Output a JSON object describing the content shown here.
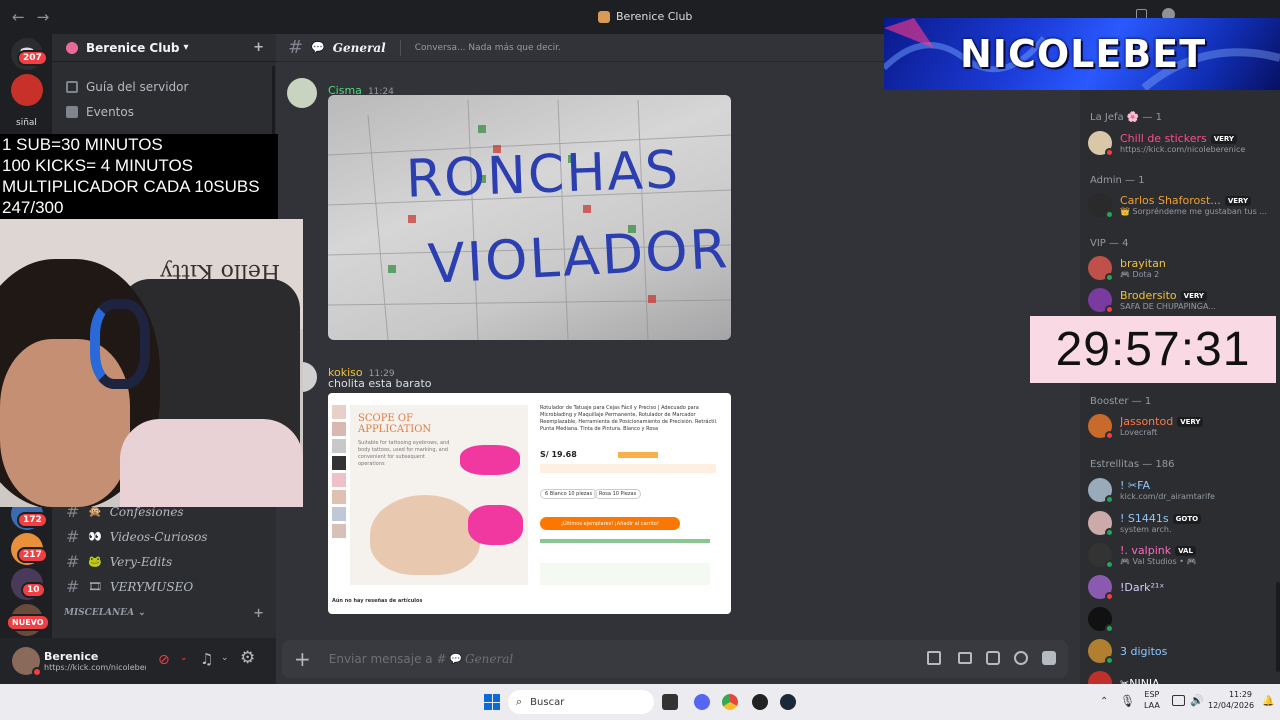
{
  "window": {
    "title": "Berenice Club",
    "back": "←",
    "forward": "→"
  },
  "server": {
    "name": "Berenice Club",
    "chevron": "▾"
  },
  "rail": {
    "dm_badge": "207",
    "server_label": "siñal",
    "badges": [
      "172",
      "217",
      "10"
    ],
    "nuevo": "NUEVO"
  },
  "sidebar": {
    "items": [
      {
        "label": "Guía del servidor",
        "icon": "signpost-icon"
      },
      {
        "label": "Eventos",
        "icon": "calendar-icon"
      }
    ],
    "channels": [
      {
        "emoji": "🙊",
        "label": "Confesiones"
      },
      {
        "emoji": "👀",
        "label": "Videos-Curiosos"
      },
      {
        "emoji": "🐸",
        "label": "Very-Edits"
      },
      {
        "emoji": "🎞",
        "label": "VERYMUSEO"
      }
    ],
    "category": "MISCELANEA"
  },
  "user": {
    "name": "Berenice",
    "status": "https://kick.com/nicoleber"
  },
  "channel": {
    "emoji": "💬",
    "name": "General",
    "topic": "Conversa... Nada más que decir."
  },
  "messages": [
    {
      "author": "Cisma",
      "time": "11:24",
      "color": "#4fdc7c",
      "image_text_1": "RONCHAS",
      "image_text_2": "VIOLADOR"
    },
    {
      "author": "kokiso",
      "time": "11:29",
      "color": "#f0c23b",
      "text": "cholita esta barato",
      "product": {
        "scope_title": "SCOPE OF APPLICATION",
        "scope_desc": "Suitable for tattooing eyebrows, and body tattoos, used for marking, and convenient for subsequent operations",
        "name": "Rotulador de Tatuaje para Cejas Fácil y Preciso | Adecuado para Microblading y Maquillaje Permanente, Rotulador de Marcador Reemplazable, Herramienta de Posicionamiento de Precisión. Retráctil. Punta Mediana. Tinta de Pintura. Blanco y Rosa",
        "price": "S/ 19.68",
        "button": "¡Últimos ejemplares! ¡Añadir al carrito!",
        "opt1": "6 Blanco 10 piezas",
        "opt2": "Rosa 10 Piezas",
        "reviews": "Aún no hay reseñas de artículos"
      }
    }
  ],
  "composer": {
    "placeholder": "Enviar mensaje a #",
    "channel": "General"
  },
  "members": {
    "groups": [
      {
        "label": "La Jefa 🌸 — 1"
      },
      {
        "label": "Admin — 1"
      },
      {
        "label": "VIP — 4"
      },
      {
        "label": "Booster — 1"
      },
      {
        "label": "Estrellitas — 186"
      }
    ],
    "list": [
      {
        "name": "Chill de stickers",
        "tag": "VERY",
        "sub": "https://kick.com/nicoleberenice",
        "color": "#ff4d8d",
        "av": "#d8c8a8",
        "st": "#f23f43"
      },
      {
        "name": "Carlos Shaforost...",
        "tag": "VERY",
        "sub": "👑 Sorpréndeme me gustaban tus ...",
        "color": "#f0a030",
        "av": "#2a2a2a",
        "st": "#23a55a"
      },
      {
        "name": "brayitan",
        "tag": "",
        "sub": "🎮 Dota 2",
        "color": "#f0c23b",
        "av": "#c0504a",
        "st": "#23a55a"
      },
      {
        "name": "Brodersito",
        "tag": "VERY",
        "sub": "SAFA DE CHUPAPINGA...",
        "color": "#f0c23b",
        "av": "#7a3aa0",
        "st": "#f23f43"
      },
      {
        "name": "Jassontod",
        "tag": "VERY",
        "sub": "Lovecraft",
        "color": "#ff7a4a",
        "av": "#c86a2a",
        "st": "#f23f43"
      },
      {
        "name": "! ✂FA",
        "tag": "",
        "sub": "kick.com/dr_airamtarife",
        "color": "#8ec8ff",
        "av": "#9ab",
        "st": "#23a55a"
      },
      {
        "name": "! S1441s",
        "tag": "GOTO",
        "sub": "system arch.",
        "color": "#8ec8ff",
        "av": "#caa",
        "st": "#23a55a"
      },
      {
        "name": "!. valpink",
        "tag": "VAL",
        "sub": "🎮 Val Studios • 🎮",
        "color": "#ff6ac1",
        "av": "#333",
        "st": "#23a55a"
      },
      {
        "name": "!Dark²¹ˣ",
        "tag": "",
        "sub": "",
        "color": "#cfcfff",
        "av": "#8a5ab0",
        "st": "#f23f43"
      },
      {
        "name": "",
        "tag": "",
        "sub": "",
        "color": "#fff",
        "av": "#111",
        "st": "#23a55a"
      },
      {
        "name": "3 digitos",
        "tag": "",
        "sub": "",
        "color": "#8ec8ff",
        "av": "#b08030",
        "st": "#23a55a"
      },
      {
        "name": "✂NINJA",
        "tag": "",
        "sub": "",
        "color": "#fff",
        "av": "#c0302a",
        "st": "#f23f43"
      }
    ]
  },
  "overlay": {
    "banner": "NICOLEBET",
    "subs": [
      "1 SUB=30 MINUTOS",
      "100 KICKS= 4 MINUTOS",
      "MULTIPLICADOR CADA 10SUBS",
      "247/300"
    ],
    "cam_wall_text": "Hello Kitty",
    "timer": "29:57:31"
  },
  "taskbar": {
    "search": "Buscar",
    "lang1": "ESP",
    "lang2": "LAA",
    "time": "11:29",
    "date": "12/04/2026"
  }
}
